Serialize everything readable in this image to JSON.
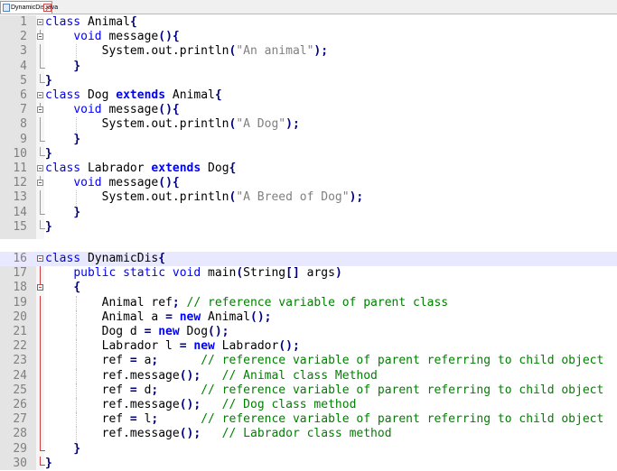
{
  "tab": {
    "filename": "DynamicDis.java"
  },
  "block1": [
    {
      "num": "1",
      "parts": [
        {
          "c": "kw",
          "t": "class"
        },
        {
          "c": "",
          "t": " Animal"
        },
        {
          "c": "op",
          "t": "{"
        }
      ]
    },
    {
      "num": "2",
      "parts": [
        {
          "c": "",
          "t": "    "
        },
        {
          "c": "kw",
          "t": "void"
        },
        {
          "c": "",
          "t": " message"
        },
        {
          "c": "op",
          "t": "(){"
        }
      ]
    },
    {
      "num": "3",
      "parts": [
        {
          "c": "",
          "t": "        System.out.println"
        },
        {
          "c": "op",
          "t": "("
        },
        {
          "c": "str",
          "t": "\"An animal\""
        },
        {
          "c": "op",
          "t": ");"
        }
      ]
    },
    {
      "num": "4",
      "parts": [
        {
          "c": "",
          "t": "    "
        },
        {
          "c": "op",
          "t": "}"
        }
      ]
    },
    {
      "num": "5",
      "parts": [
        {
          "c": "op",
          "t": "}"
        }
      ]
    },
    {
      "num": "6",
      "parts": [
        {
          "c": "kw",
          "t": "class"
        },
        {
          "c": "",
          "t": " Dog "
        },
        {
          "c": "kwb",
          "t": "extends"
        },
        {
          "c": "",
          "t": " Animal"
        },
        {
          "c": "op",
          "t": "{"
        }
      ]
    },
    {
      "num": "7",
      "parts": [
        {
          "c": "",
          "t": "    "
        },
        {
          "c": "kw",
          "t": "void"
        },
        {
          "c": "",
          "t": " message"
        },
        {
          "c": "op",
          "t": "(){"
        }
      ]
    },
    {
      "num": "8",
      "parts": [
        {
          "c": "",
          "t": "        System.out.println"
        },
        {
          "c": "op",
          "t": "("
        },
        {
          "c": "str",
          "t": "\"A Dog\""
        },
        {
          "c": "op",
          "t": ");"
        }
      ]
    },
    {
      "num": "9",
      "parts": [
        {
          "c": "",
          "t": "    "
        },
        {
          "c": "op",
          "t": "}"
        }
      ]
    },
    {
      "num": "10",
      "parts": [
        {
          "c": "op",
          "t": "}"
        }
      ]
    },
    {
      "num": "11",
      "parts": [
        {
          "c": "kw",
          "t": "class"
        },
        {
          "c": "",
          "t": " Labrador "
        },
        {
          "c": "kwb",
          "t": "extends"
        },
        {
          "c": "",
          "t": " Dog"
        },
        {
          "c": "op",
          "t": "{"
        }
      ]
    },
    {
      "num": "12",
      "parts": [
        {
          "c": "",
          "t": "    "
        },
        {
          "c": "kw",
          "t": "void"
        },
        {
          "c": "",
          "t": " message"
        },
        {
          "c": "op",
          "t": "(){"
        }
      ]
    },
    {
      "num": "13",
      "parts": [
        {
          "c": "",
          "t": "        System.out.println"
        },
        {
          "c": "op",
          "t": "("
        },
        {
          "c": "str",
          "t": "\"A Breed of Dog\""
        },
        {
          "c": "op",
          "t": ");"
        }
      ]
    },
    {
      "num": "14",
      "parts": [
        {
          "c": "",
          "t": "    "
        },
        {
          "c": "op",
          "t": "}"
        }
      ]
    },
    {
      "num": "15",
      "parts": [
        {
          "c": "op",
          "t": "}"
        }
      ]
    }
  ],
  "block2": [
    {
      "num": "16",
      "parts": [
        {
          "c": "kw",
          "t": "class"
        },
        {
          "c": "",
          "t": " DynamicDis"
        },
        {
          "c": "op",
          "t": "{"
        }
      ]
    },
    {
      "num": "17",
      "parts": [
        {
          "c": "",
          "t": "    "
        },
        {
          "c": "kw",
          "t": "public static void"
        },
        {
          "c": "",
          "t": " main"
        },
        {
          "c": "op",
          "t": "("
        },
        {
          "c": "",
          "t": "String"
        },
        {
          "c": "op",
          "t": "[]"
        },
        {
          "c": "",
          "t": " args"
        },
        {
          "c": "op",
          "t": ")"
        }
      ]
    },
    {
      "num": "18",
      "parts": [
        {
          "c": "",
          "t": "    "
        },
        {
          "c": "op",
          "t": "{"
        }
      ]
    },
    {
      "num": "19",
      "parts": [
        {
          "c": "",
          "t": "        Animal ref"
        },
        {
          "c": "op",
          "t": ";"
        },
        {
          "c": "cm",
          "t": " // reference variable of parent class"
        }
      ]
    },
    {
      "num": "20",
      "parts": [
        {
          "c": "",
          "t": "        Animal a "
        },
        {
          "c": "op",
          "t": "="
        },
        {
          "c": "",
          "t": " "
        },
        {
          "c": "kwb",
          "t": "new"
        },
        {
          "c": "",
          "t": " Animal"
        },
        {
          "c": "op",
          "t": "();"
        }
      ]
    },
    {
      "num": "21",
      "parts": [
        {
          "c": "",
          "t": "        Dog d "
        },
        {
          "c": "op",
          "t": "="
        },
        {
          "c": "",
          "t": " "
        },
        {
          "c": "kwb",
          "t": "new"
        },
        {
          "c": "",
          "t": " Dog"
        },
        {
          "c": "op",
          "t": "();"
        }
      ]
    },
    {
      "num": "22",
      "parts": [
        {
          "c": "",
          "t": "        Labrador l "
        },
        {
          "c": "op",
          "t": "="
        },
        {
          "c": "",
          "t": " "
        },
        {
          "c": "kwb",
          "t": "new"
        },
        {
          "c": "",
          "t": " Labrador"
        },
        {
          "c": "op",
          "t": "();"
        }
      ]
    },
    {
      "num": "23",
      "parts": [
        {
          "c": "",
          "t": "        ref "
        },
        {
          "c": "op",
          "t": "="
        },
        {
          "c": "",
          "t": " a"
        },
        {
          "c": "op",
          "t": ";"
        },
        {
          "c": "cm",
          "t": "      // reference variable of parent referring to child object"
        }
      ]
    },
    {
      "num": "24",
      "parts": [
        {
          "c": "",
          "t": "        ref.message"
        },
        {
          "c": "op",
          "t": "();"
        },
        {
          "c": "cm",
          "t": "   // Animal class Method"
        }
      ]
    },
    {
      "num": "25",
      "parts": [
        {
          "c": "",
          "t": "        ref "
        },
        {
          "c": "op",
          "t": "="
        },
        {
          "c": "",
          "t": " d"
        },
        {
          "c": "op",
          "t": ";"
        },
        {
          "c": "cm",
          "t": "      // reference variable of parent referring to child object"
        }
      ]
    },
    {
      "num": "26",
      "parts": [
        {
          "c": "",
          "t": "        ref.message"
        },
        {
          "c": "op",
          "t": "();"
        },
        {
          "c": "cm",
          "t": "   // Dog class method"
        }
      ]
    },
    {
      "num": "27",
      "parts": [
        {
          "c": "",
          "t": "        ref "
        },
        {
          "c": "op",
          "t": "="
        },
        {
          "c": "",
          "t": " l"
        },
        {
          "c": "op",
          "t": ";"
        },
        {
          "c": "cm",
          "t": "      // reference variable of parent referring to child object"
        }
      ]
    },
    {
      "num": "28",
      "parts": [
        {
          "c": "",
          "t": "        ref.message"
        },
        {
          "c": "op",
          "t": "();"
        },
        {
          "c": "cm",
          "t": "   // Labrador class method"
        }
      ]
    },
    {
      "num": "29",
      "parts": [
        {
          "c": "",
          "t": "    "
        },
        {
          "c": "op",
          "t": "}"
        }
      ]
    },
    {
      "num": "30",
      "parts": [
        {
          "c": "op",
          "t": "}"
        }
      ]
    }
  ]
}
